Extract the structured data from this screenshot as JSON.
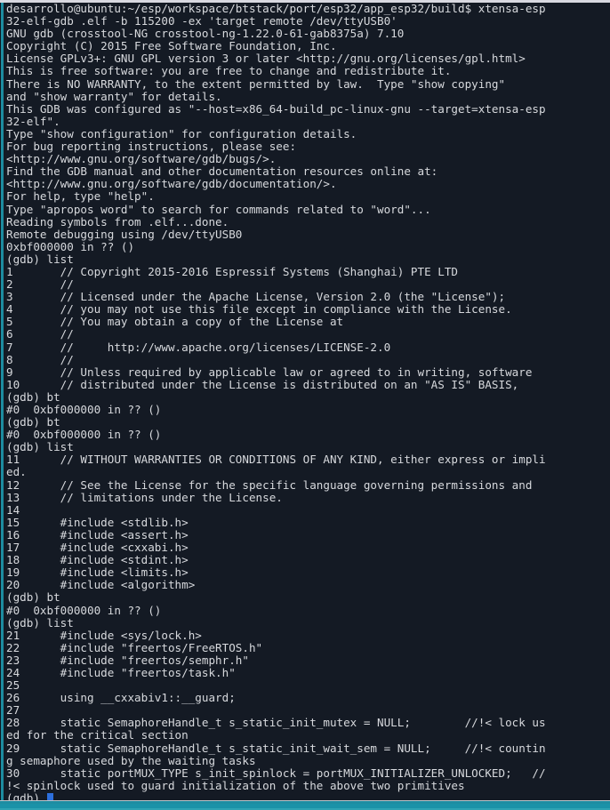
{
  "window": {
    "app": "gnome-terminal",
    "title": "desarrollo@ubuntu: ~/esp/workspace/btstack/port/esp32/app_esp32/build",
    "colors": {
      "background": "#141a24",
      "foreground": "#d7d9dd",
      "accent_teal": "#1d8da2",
      "cursor": "#2d6fdd",
      "chrome": "#d8d8e0"
    }
  },
  "terminal": {
    "prompt": "(gdb)",
    "shell_prompt": "desarrollo@ubuntu:~/esp/workspace/btstack/port/esp32/app_esp32/build$",
    "cursor_visible": true,
    "lines": [
      "desarrollo@ubuntu:~/esp/workspace/btstack/port/esp32/app_esp32/build$ xtensa-esp",
      "32-elf-gdb .elf -b 115200 -ex 'target remote /dev/ttyUSB0'",
      "GNU gdb (crosstool-NG crosstool-ng-1.22.0-61-gab8375a) 7.10",
      "Copyright (C) 2015 Free Software Foundation, Inc.",
      "License GPLv3+: GNU GPL version 3 or later <http://gnu.org/licenses/gpl.html>",
      "This is free software: you are free to change and redistribute it.",
      "There is NO WARRANTY, to the extent permitted by law.  Type \"show copying\"",
      "and \"show warranty\" for details.",
      "This GDB was configured as \"--host=x86_64-build_pc-linux-gnu --target=xtensa-esp",
      "32-elf\".",
      "Type \"show configuration\" for configuration details.",
      "For bug reporting instructions, please see:",
      "<http://www.gnu.org/software/gdb/bugs/>.",
      "Find the GDB manual and other documentation resources online at:",
      "<http://www.gnu.org/software/gdb/documentation/>.",
      "For help, type \"help\".",
      "Type \"apropos word\" to search for commands related to \"word\"...",
      "Reading symbols from .elf...done.",
      "Remote debugging using /dev/ttyUSB0",
      "0xbf000000 in ?? ()",
      "(gdb) list",
      "1\t// Copyright 2015-2016 Espressif Systems (Shanghai) PTE LTD",
      "2\t//",
      "3\t// Licensed under the Apache License, Version 2.0 (the \"License\");",
      "4\t// you may not use this file except in compliance with the License.",
      "5\t// You may obtain a copy of the License at",
      "6\t//",
      "7\t//     http://www.apache.org/licenses/LICENSE-2.0",
      "8\t//",
      "9\t// Unless required by applicable law or agreed to in writing, software",
      "10\t// distributed under the License is distributed on an \"AS IS\" BASIS,",
      "(gdb) bt",
      "#0  0xbf000000 in ?? ()",
      "(gdb) bt",
      "#0  0xbf000000 in ?? ()",
      "(gdb) list",
      "11\t// WITHOUT WARRANTIES OR CONDITIONS OF ANY KIND, either express or impli",
      "ed.",
      "12\t// See the License for the specific language governing permissions and",
      "13\t// limitations under the License.",
      "14",
      "15\t#include <stdlib.h>",
      "16\t#include <assert.h>",
      "17\t#include <cxxabi.h>",
      "18\t#include <stdint.h>",
      "19\t#include <limits.h>",
      "20\t#include <algorithm>",
      "(gdb) bt",
      "#0  0xbf000000 in ?? ()",
      "(gdb) list",
      "21\t#include <sys/lock.h>",
      "22\t#include \"freertos/FreeRTOS.h\"",
      "23\t#include \"freertos/semphr.h\"",
      "24\t#include \"freertos/task.h\"",
      "25",
      "26\tusing __cxxabiv1::__guard;",
      "27",
      "28\tstatic SemaphoreHandle_t s_static_init_mutex = NULL;        //!< lock us",
      "ed for the critical section",
      "29\tstatic SemaphoreHandle_t s_static_init_wait_sem = NULL;     //!< countin",
      "g semaphore used by the waiting tasks",
      "30\tstatic portMUX_TYPE s_init_spinlock = portMUX_INITIALIZER_UNLOCKED;   //",
      "!< spinlock used to guard initialization of the above two primitives"
    ],
    "last_line": "(gdb) "
  }
}
